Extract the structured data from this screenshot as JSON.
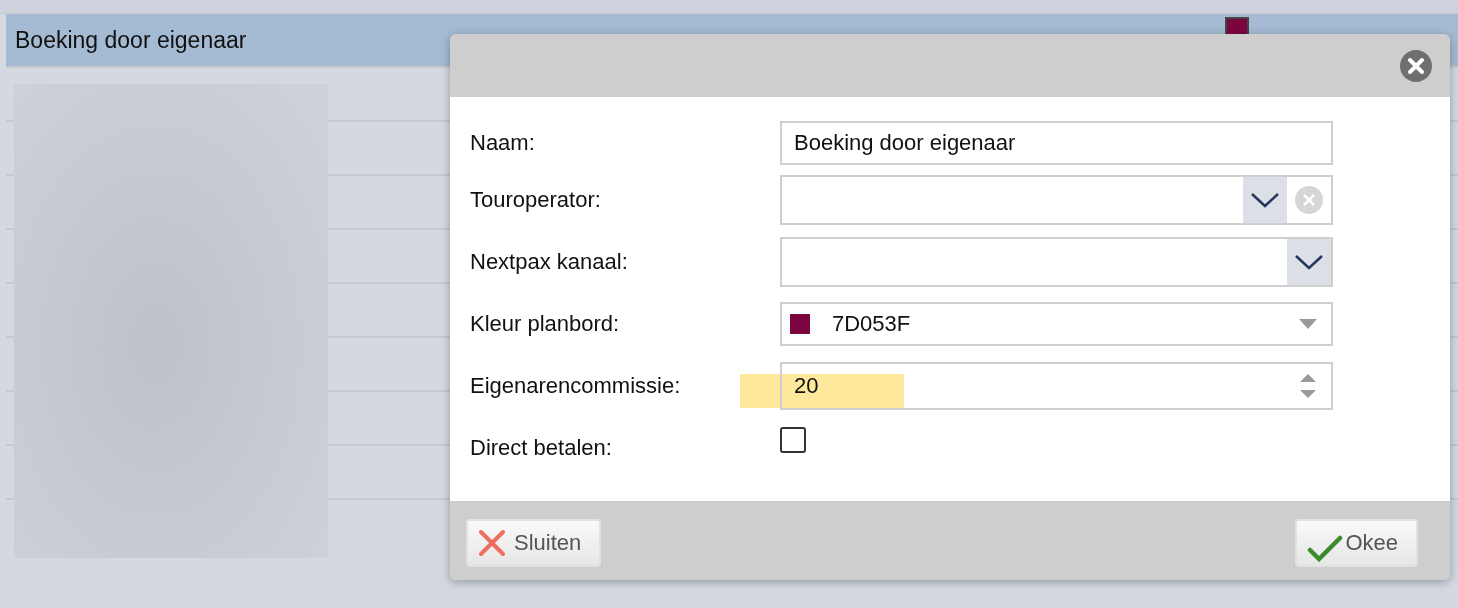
{
  "list": {
    "rows": [
      {
        "name": "Boeking door eigenaar",
        "color": "#7d053f",
        "selected": true
      }
    ]
  },
  "dialog": {
    "fields": [
      {
        "kind": "text",
        "label": "Naam:",
        "value": "Boeking door eigenaar"
      },
      {
        "kind": "select_clearable",
        "label": "Touroperator:"
      },
      {
        "kind": "select",
        "label": "Nextpax kanaal:"
      },
      {
        "kind": "color_select",
        "label": "Kleur planbord:",
        "value": "7D053F",
        "color": "#7d053f"
      },
      {
        "kind": "number",
        "label": "Eigenarencommissie:",
        "value": "20",
        "highlighted": true
      },
      {
        "kind": "checkbox",
        "label": "Direct betalen:",
        "checked": false
      }
    ],
    "buttons": [
      {
        "kind": "close",
        "label": "Sluiten"
      },
      {
        "kind": "ok",
        "label": "Okee"
      }
    ]
  }
}
